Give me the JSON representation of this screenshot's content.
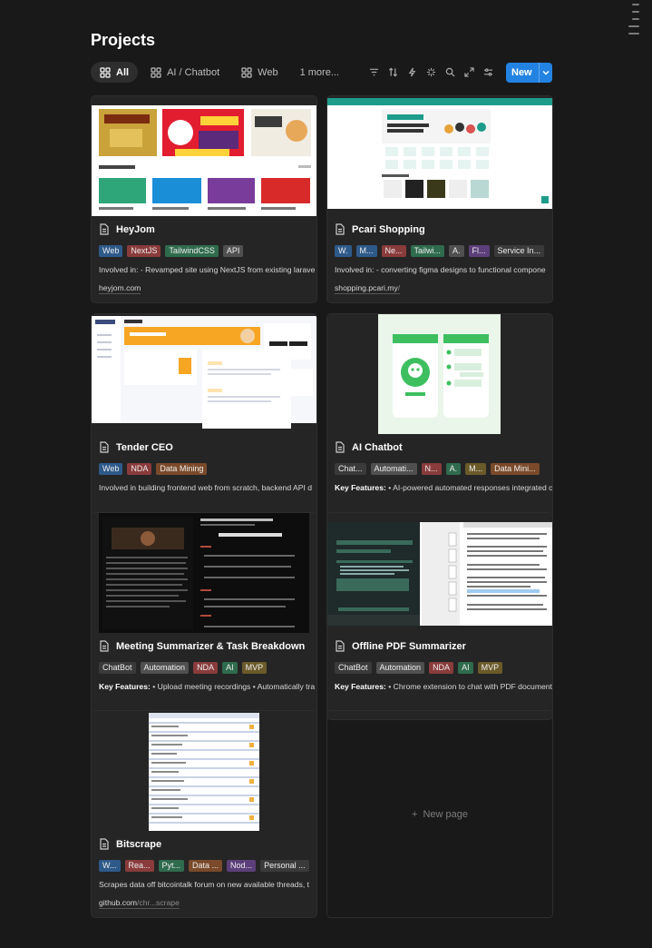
{
  "page": {
    "title": "Projects"
  },
  "tabs": [
    {
      "label": "All",
      "active": true
    },
    {
      "label": "AI / Chatbot",
      "active": false
    },
    {
      "label": "Web",
      "active": false
    },
    {
      "label": "1 more...",
      "active": false
    }
  ],
  "toolbar": {
    "new_label": "New"
  },
  "tag_colors": {
    "blue": "#2e5a8a",
    "red": "#8a3b3b",
    "green": "#2f6b4d",
    "gray": "#505050",
    "dark": "#3a3a3a",
    "brown": "#7a4a2a",
    "purple": "#5c3f7a",
    "olive": "#6b5a2a"
  },
  "cards": [
    {
      "name": "HeyJom",
      "tags": [
        {
          "label": "Web",
          "color": "blue"
        },
        {
          "label": "NextJS",
          "color": "red"
        },
        {
          "label": "TailwindCSS",
          "color": "green"
        },
        {
          "label": "API",
          "color": "gray"
        }
      ],
      "desc_bold": "",
      "desc": "Involved in: - Revamped site using NextJS from existing larave",
      "url": "heyjom.com",
      "url_muted": ""
    },
    {
      "name": "Pcari Shopping",
      "tags": [
        {
          "label": "W.",
          "color": "blue"
        },
        {
          "label": "M...",
          "color": "blue"
        },
        {
          "label": "Ne...",
          "color": "red"
        },
        {
          "label": "Tailwi...",
          "color": "green"
        },
        {
          "label": "A.",
          "color": "gray"
        },
        {
          "label": "Fl...",
          "color": "purple"
        },
        {
          "label": "Service In...",
          "color": "dark"
        }
      ],
      "desc_bold": "",
      "desc": "Involved in: - converting figma designs to functional compone",
      "url": "shopping.pcari.my",
      "url_muted": "/"
    },
    {
      "name": "Tender CEO",
      "tags": [
        {
          "label": "Web",
          "color": "blue"
        },
        {
          "label": "NDA",
          "color": "red"
        },
        {
          "label": "Data Mining",
          "color": "brown"
        }
      ],
      "desc_bold": "",
      "desc": "Involved in building frontend web from scratch, backend API d",
      "url": "",
      "url_muted": ""
    },
    {
      "name": "AI Chatbot",
      "tags": [
        {
          "label": "Chat...",
          "color": "dark"
        },
        {
          "label": "Automati...",
          "color": "gray"
        },
        {
          "label": "N...",
          "color": "red"
        },
        {
          "label": "A.",
          "color": "green"
        },
        {
          "label": "M...",
          "color": "olive"
        },
        {
          "label": "Data Mini...",
          "color": "brown"
        }
      ],
      "desc_bold": "Key Features:",
      "desc": " • AI-powered automated responses integrated c",
      "url": "",
      "url_muted": ""
    },
    {
      "name": "Meeting Summarizer & Task Breakdown",
      "tags": [
        {
          "label": "ChatBot",
          "color": "dark"
        },
        {
          "label": "Automation",
          "color": "gray"
        },
        {
          "label": "NDA",
          "color": "red"
        },
        {
          "label": "AI",
          "color": "green"
        },
        {
          "label": "MVP",
          "color": "olive"
        }
      ],
      "desc_bold": "Key Features:",
      "desc": " • Upload meeting recordings • Automatically tra",
      "url": "",
      "url_muted": ""
    },
    {
      "name": "Offline PDF Summarizer",
      "tags": [
        {
          "label": "ChatBot",
          "color": "dark"
        },
        {
          "label": "Automation",
          "color": "gray"
        },
        {
          "label": "NDA",
          "color": "red"
        },
        {
          "label": "AI",
          "color": "green"
        },
        {
          "label": "MVP",
          "color": "olive"
        }
      ],
      "desc_bold": "Key Features:",
      "desc": " • Chrome extension to chat with PDF document",
      "url": "",
      "url_muted": ""
    },
    {
      "name": "Bitscrape",
      "tags": [
        {
          "label": "W...",
          "color": "blue"
        },
        {
          "label": "Rea...",
          "color": "red"
        },
        {
          "label": "Pyt...",
          "color": "green"
        },
        {
          "label": "Data ...",
          "color": "brown"
        },
        {
          "label": "Nod...",
          "color": "purple"
        },
        {
          "label": "Personal ...",
          "color": "dark"
        }
      ],
      "desc_bold": "",
      "desc": "Scrapes data off bitcointalk forum on new available threads, t",
      "url": "github.com",
      "url_muted": "/chr...scrape"
    }
  ],
  "new_page_label": "New page"
}
